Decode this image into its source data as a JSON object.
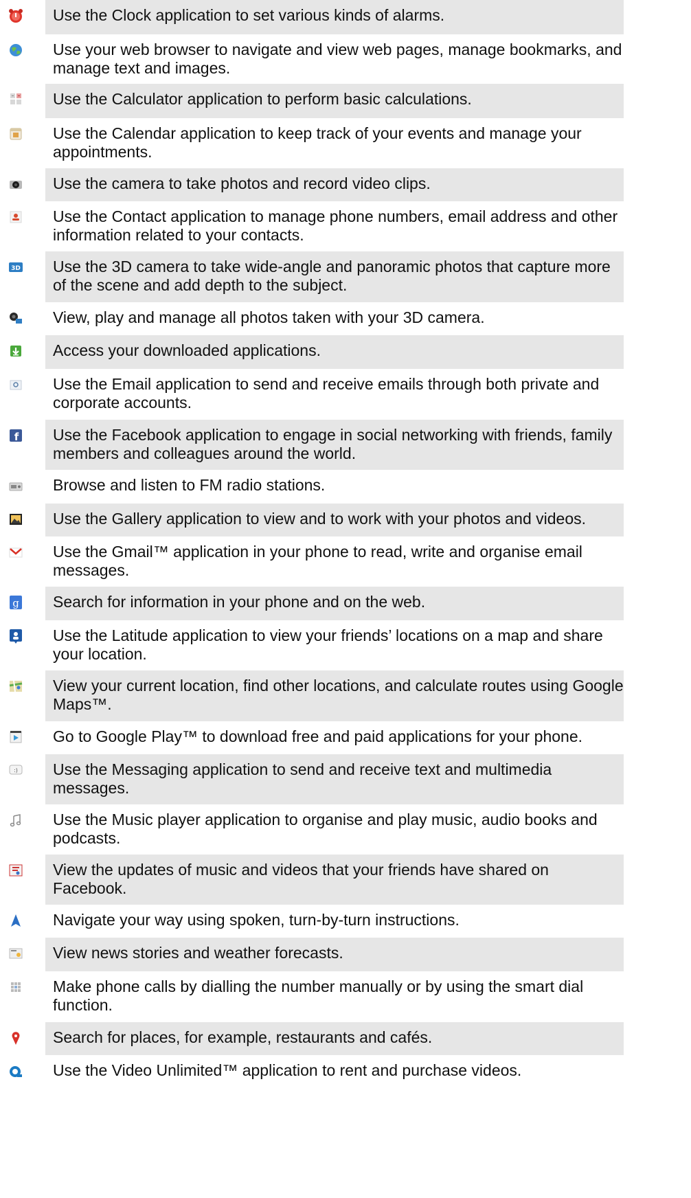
{
  "rows": [
    {
      "icon": "alarm-clock-icon",
      "text": "Use the Clock application to set various kinds of alarms.",
      "shaded": true
    },
    {
      "icon": "web-browser-globe-icon",
      "text": "Use your web browser to navigate and view web pages, manage bookmarks, and manage text and images.",
      "shaded": false
    },
    {
      "icon": "calculator-icon",
      "text": "Use the Calculator application to perform basic calculations.",
      "shaded": true
    },
    {
      "icon": "calendar-icon",
      "text": "Use the Calendar application to keep track of your events and manage your appointments.",
      "shaded": false
    },
    {
      "icon": "camera-icon",
      "text": "Use the camera to take photos and record video clips.",
      "shaded": true
    },
    {
      "icon": "contacts-icon",
      "text": "Use the Contact application to manage phone numbers, email address and other information related to your contacts.",
      "shaded": false
    },
    {
      "icon": "3d-camera-icon",
      "text": "Use the 3D camera to take wide-angle and panoramic photos that capture more of the scene and add depth to the subject.",
      "shaded": true
    },
    {
      "icon": "3d-photo-viewer-icon",
      "text": "View, play and manage all photos taken with your 3D camera.",
      "shaded": false
    },
    {
      "icon": "downloads-icon",
      "text": "Access your downloaded applications.",
      "shaded": true
    },
    {
      "icon": "email-icon",
      "text": "Use the Email application to send and receive emails through both private and corporate accounts.",
      "shaded": false
    },
    {
      "icon": "facebook-icon",
      "text": "Use the Facebook application to engage in social networking with friends, family members and colleagues around the world.",
      "shaded": true
    },
    {
      "icon": "fm-radio-icon",
      "text": "Browse and listen to FM radio stations.",
      "shaded": false
    },
    {
      "icon": "gallery-icon",
      "text": "Use the Gallery application to view and to work with your photos and videos.",
      "shaded": true
    },
    {
      "icon": "gmail-icon",
      "text": "Use the Gmail™ application in your phone to read, write and organise email messages.",
      "shaded": false
    },
    {
      "icon": "google-search-icon",
      "text": "Search for information in your phone and on the web.",
      "shaded": true
    },
    {
      "icon": "latitude-icon",
      "text": "Use the Latitude application to view your friends’ locations on a map and share your location.",
      "shaded": false
    },
    {
      "icon": "maps-icon",
      "text": "View your current location, find other locations, and calculate routes using Google Maps™.",
      "shaded": true
    },
    {
      "icon": "google-play-icon",
      "text": "Go to Google Play™ to download free and paid applications for your phone.",
      "shaded": false
    },
    {
      "icon": "messaging-icon",
      "text": "Use the Messaging application to send and receive text and multimedia messages.",
      "shaded": true
    },
    {
      "icon": "music-note-icon",
      "text": "Use the Music player application to organise and play music, audio books and podcasts.",
      "shaded": false
    },
    {
      "icon": "music-video-updates-icon",
      "text": "View the updates of music and videos that your friends have shared on Facebook.",
      "shaded": true
    },
    {
      "icon": "navigation-arrow-icon",
      "text": "Navigate your way using spoken, turn-by-turn instructions.",
      "shaded": false
    },
    {
      "icon": "news-weather-icon",
      "text": "View news stories and weather forecasts.",
      "shaded": true
    },
    {
      "icon": "phone-dialer-icon",
      "text": "Make phone calls by dialling the number manually or by using the smart dial function.",
      "shaded": false
    },
    {
      "icon": "places-pin-icon",
      "text": "Search for places, for example, restaurants and cafés.",
      "shaded": true
    },
    {
      "icon": "video-unlimited-icon",
      "text": "Use the Video Unlimited™ application to rent and purchase videos.",
      "shaded": false
    }
  ]
}
